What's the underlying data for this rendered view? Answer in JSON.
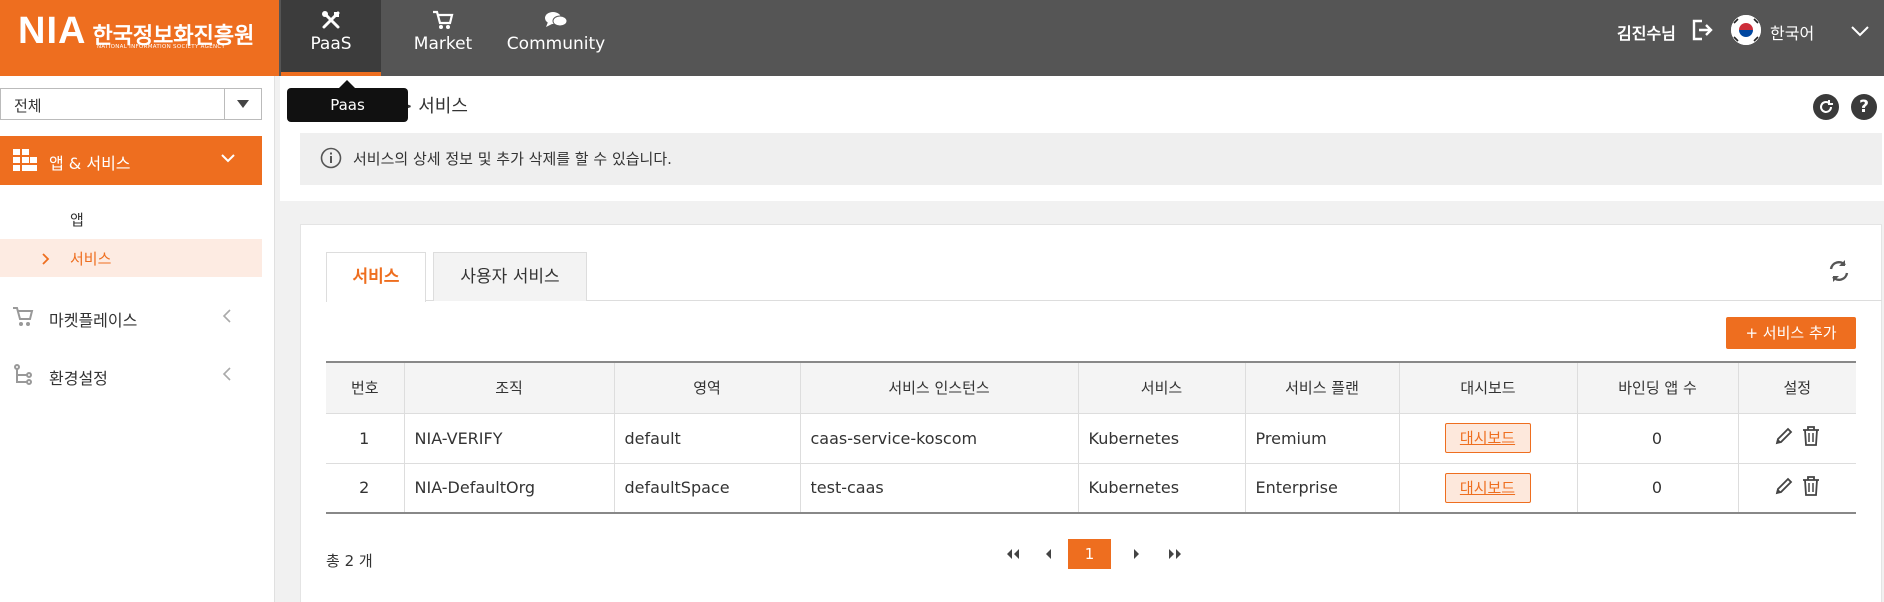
{
  "brand": {
    "name": "NIA",
    "name_ko": "한국정보화진흥원",
    "subtitle": "NATIONAL INFORMATION SOCIETY AGENCY"
  },
  "nav": [
    {
      "label": "PaaS",
      "icon": "tools-icon"
    },
    {
      "label": "Market",
      "icon": "cart-icon"
    },
    {
      "label": "Community",
      "icon": "chat-icon"
    }
  ],
  "tooltip": "Paas",
  "user": {
    "name": "김진수님",
    "language": "한국어"
  },
  "sidebar": {
    "org_select": "전체",
    "active_menu": "앱 & 서비스",
    "sub_items": [
      "앱",
      "서비스"
    ],
    "menu_items": [
      "마켓플레이스",
      "환경설정"
    ]
  },
  "breadcrumb": "앱 & 서비스 > 서비스",
  "info": "서비스의 상세 정보 및 추가 삭제를 할 수 있습니다.",
  "tabs": [
    "서비스",
    "사용자 서비스"
  ],
  "add_button": "+ 서비스 추가",
  "table": {
    "headers": [
      "번호",
      "조직",
      "영역",
      "서비스 인스턴스",
      "서비스",
      "서비스 플랜",
      "대시보드",
      "바인딩 앱 수",
      "설정"
    ],
    "rows": [
      {
        "no": "1",
        "org": "NIA-VERIFY",
        "space": "default",
        "instance": "caas-service-koscom",
        "service": "Kubernetes",
        "plan": "Premium",
        "dashboard": "대시보드",
        "bindings": "0"
      },
      {
        "no": "2",
        "org": "NIA-DefaultOrg",
        "space": "defaultSpace",
        "instance": "test-caas",
        "service": "Kubernetes",
        "plan": "Enterprise",
        "dashboard": "대시보드",
        "bindings": "0"
      }
    ]
  },
  "total": "총 2 개",
  "pagination": {
    "current": "1"
  },
  "colors": {
    "accent": "#ee6e1f",
    "topbar": "#555555",
    "active_nav": "#3c3c3c"
  }
}
